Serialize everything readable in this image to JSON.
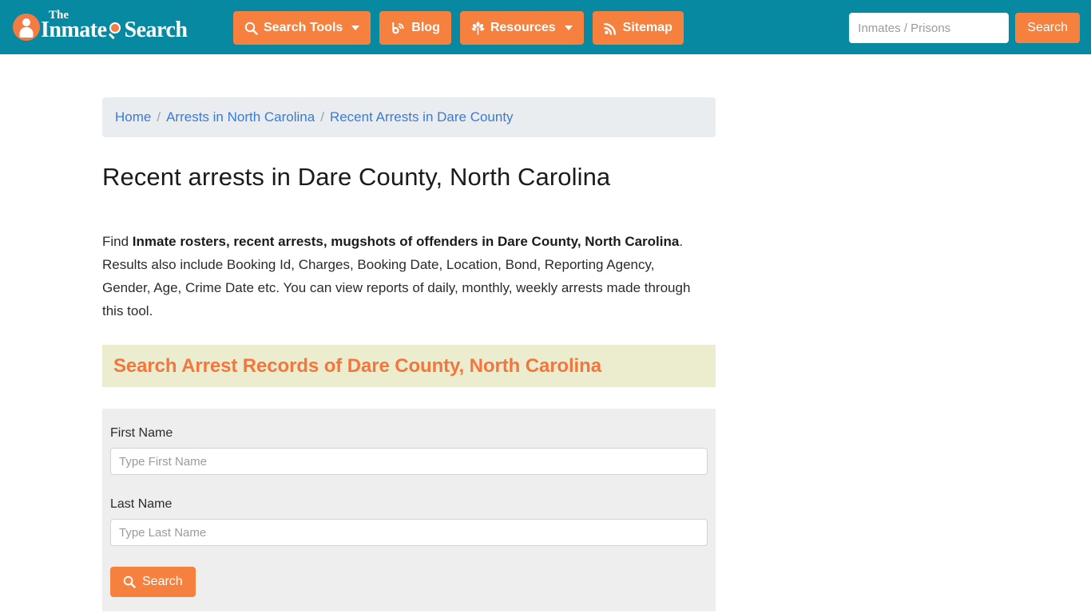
{
  "header": {
    "logo": {
      "the": "The",
      "word1": "Inmate",
      "word2": "Search",
      "icon": "magnifier-icon"
    },
    "nav": [
      {
        "label": "Search Tools",
        "icon": "magnifier-icon",
        "has_caret": true
      },
      {
        "label": "Blog",
        "icon": "blog-icon",
        "has_caret": false
      },
      {
        "label": "Resources",
        "icon": "leaf-icon",
        "has_caret": true
      },
      {
        "label": "Sitemap",
        "icon": "rss-icon",
        "has_caret": false
      }
    ],
    "search": {
      "placeholder": "Inmates / Prisons",
      "value": "",
      "button_label": "Search"
    }
  },
  "breadcrumb": {
    "items": [
      {
        "label": "Home"
      },
      {
        "label": "Arrests in North Carolina"
      },
      {
        "label": "Recent Arrests in Dare County"
      }
    ],
    "separator": "/"
  },
  "main": {
    "page_title": "Recent arrests in Dare County, North Carolina",
    "intro": {
      "lead": "Find ",
      "bold": "Inmate rosters, recent arrests, mugshots of offenders in Dare County, North Carolina",
      "rest": ". Results also include Booking Id, Charges, Booking Date, Location, Bond, Reporting Agency, Gender, Age, Crime Date etc. You can view reports of daily, monthly, weekly arrests made through this tool."
    },
    "section_heading": "Search Arrest Records of Dare County, North Carolina",
    "form": {
      "fields": [
        {
          "label": "First Name",
          "placeholder": "Type First Name",
          "value": ""
        },
        {
          "label": "Last Name",
          "placeholder": "Type Last Name",
          "value": ""
        }
      ],
      "submit_label": "Search",
      "submit_icon": "magnifier-icon"
    }
  },
  "colors": {
    "header_teal": "#0789a1",
    "accent_orange": "#f6813f",
    "heading_orange": "#f4763c",
    "banner_bg": "#ecedcf",
    "breadcrumb_bg": "#e9edf0",
    "form_bg": "#eeeeee",
    "link_blue": "#3a7bd5"
  }
}
